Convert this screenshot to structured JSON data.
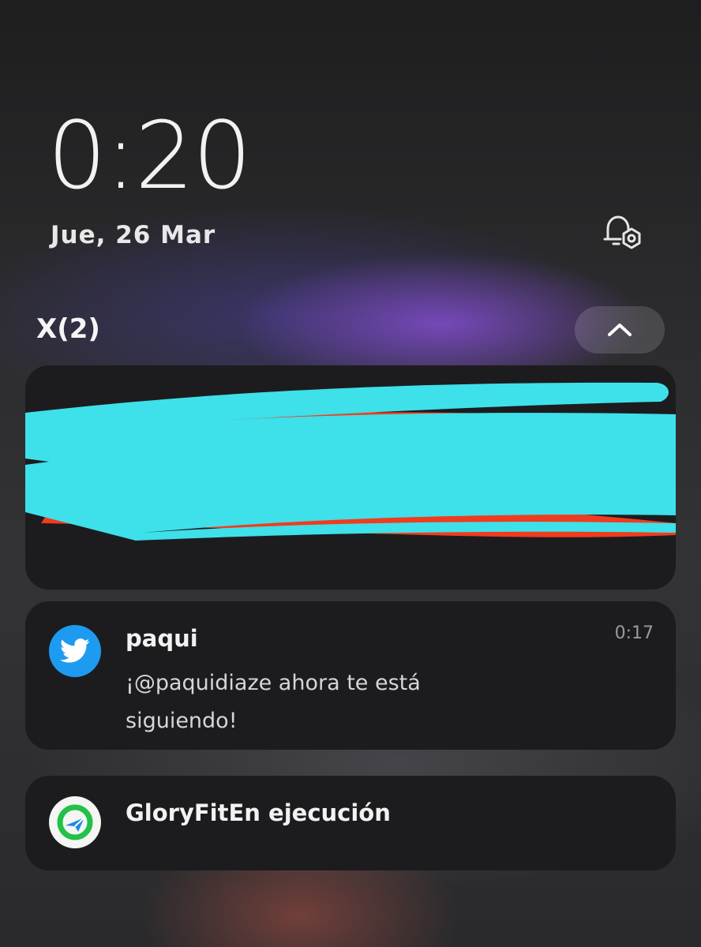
{
  "lockscreen": {
    "time": "0:20",
    "date": "Jue, 26 Mar"
  },
  "notification_group": {
    "title": "X(2)"
  },
  "notifications": [
    {
      "app_icon": "twitter-bird-icon",
      "title": "paqui",
      "time": "0:17",
      "body": "¡@paquidiaze ahora te está siguiendo!"
    },
    {
      "app_icon": "gloryfit-icon",
      "title": "GloryFitEn ejecución"
    }
  ],
  "colors": {
    "scribble_cyan": "#3ee0ea",
    "scribble_red": "#f03c1e",
    "twitter_blue": "#1d9bf0",
    "gloryfit_green": "#23c04a"
  }
}
